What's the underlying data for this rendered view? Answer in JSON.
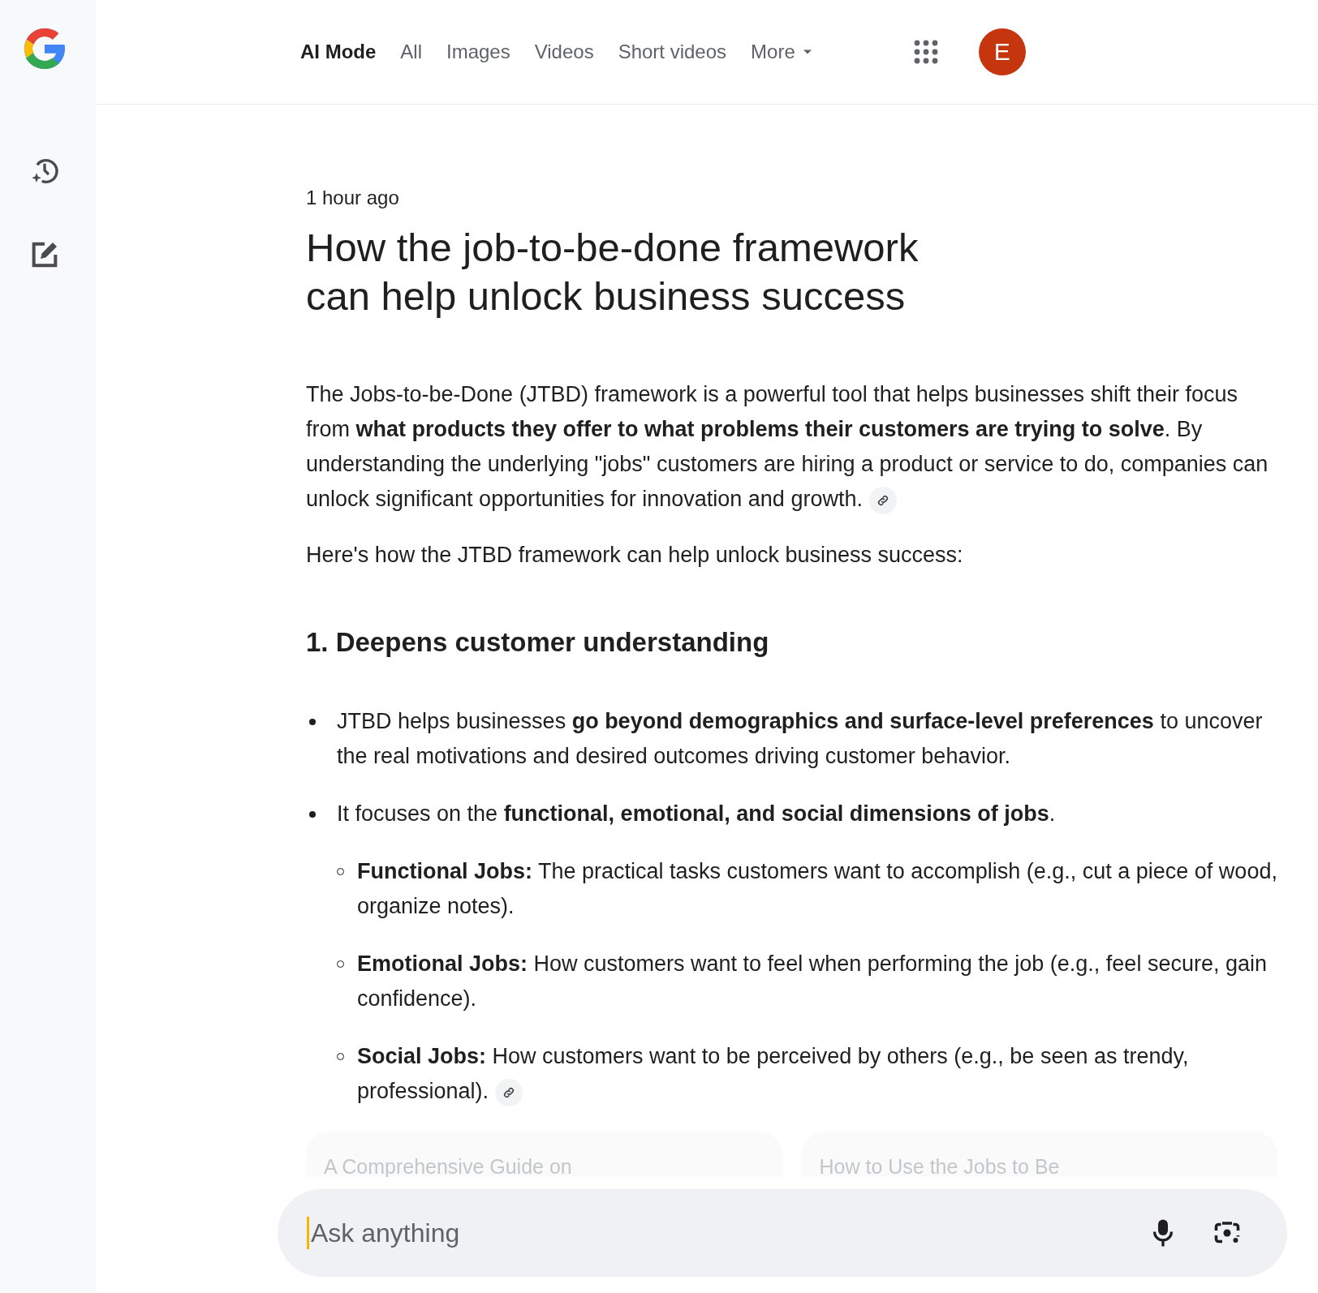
{
  "nav": {
    "tabs": [
      {
        "label": "AI Mode",
        "selected": true
      },
      {
        "label": "All",
        "selected": false
      },
      {
        "label": "Images",
        "selected": false
      },
      {
        "label": "Videos",
        "selected": false
      },
      {
        "label": "Short videos",
        "selected": false
      }
    ],
    "more": "More"
  },
  "avatar": "E",
  "timestamp": "1 hour ago",
  "title": "How the job-to-be-done framework can help unlock business success",
  "blocks": [
    {
      "kind": "paragraph",
      "text": "The Jobs-to-be-Done (JTBD) framework is a powerful tool that helps businesses shift their focus from **what products they offer to what problems their customers are trying to solve**. By understanding the underlying \"jobs\" customers are hiring a product or service to do, companies can unlock significant opportunities for innovation and growth.",
      "link": true
    },
    {
      "kind": "paragraph",
      "text": "Here's how the JTBD framework can help unlock business success:",
      "link": false
    },
    {
      "kind": "heading",
      "text": "1. Deepens customer understanding"
    },
    {
      "kind": "bullets",
      "items": [
        {
          "text": "JTBD helps businesses **go beyond demographics and surface-level preferences** to uncover the real motivations and desired outcomes driving customer behavior.",
          "link": false
        },
        {
          "text": "It focuses on the **functional, emotional, and social dimensions of jobs**.",
          "link": false,
          "children": [
            {
              "text": "**Functional Jobs:** The practical tasks customers want to accomplish (e.g., cut a piece of wood, organize notes).",
              "link": false
            },
            {
              "text": "**Emotional Jobs:** How customers want to feel when performing the job (e.g., feel secure, gain confidence).",
              "link": false
            },
            {
              "text": "**Social Jobs:** How customers want to be perceived by others (e.g., be seen as trendy, professional).",
              "link": true
            }
          ]
        }
      ]
    }
  ],
  "cards": [
    {
      "title": "A Comprehensive Guide on"
    },
    {
      "title": "How to Use the Jobs to Be"
    }
  ],
  "search": {
    "placeholder": "Ask anything"
  }
}
